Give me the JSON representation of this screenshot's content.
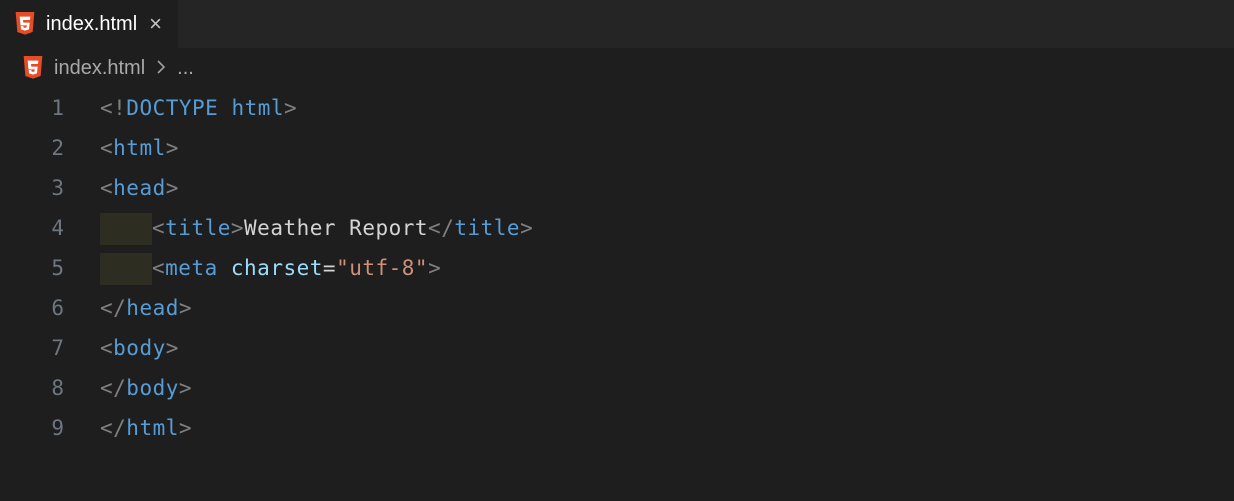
{
  "tab": {
    "title": "index.html"
  },
  "breadcrumb": {
    "file": "index.html",
    "rest": "..."
  },
  "lines": [
    {
      "num": "1",
      "indent": 0,
      "highlightIndent": false,
      "tokens": [
        {
          "cls": "p-gray",
          "t": "<!"
        },
        {
          "cls": "p-blue",
          "t": "DOCTYPE"
        },
        {
          "cls": "p-white",
          "t": " "
        },
        {
          "cls": "p-blue",
          "t": "html"
        },
        {
          "cls": "p-gray",
          "t": ">"
        }
      ]
    },
    {
      "num": "2",
      "indent": 0,
      "highlightIndent": false,
      "tokens": [
        {
          "cls": "p-gray",
          "t": "<"
        },
        {
          "cls": "p-blue",
          "t": "html"
        },
        {
          "cls": "p-gray",
          "t": ">"
        }
      ]
    },
    {
      "num": "3",
      "indent": 0,
      "highlightIndent": false,
      "tokens": [
        {
          "cls": "p-gray",
          "t": "<"
        },
        {
          "cls": "p-blue",
          "t": "head"
        },
        {
          "cls": "p-gray",
          "t": ">"
        }
      ]
    },
    {
      "num": "4",
      "indent": 1,
      "highlightIndent": true,
      "tokens": [
        {
          "cls": "p-gray",
          "t": "<"
        },
        {
          "cls": "p-blue",
          "t": "title"
        },
        {
          "cls": "p-gray",
          "t": ">"
        },
        {
          "cls": "p-white",
          "t": "Weather Report"
        },
        {
          "cls": "p-gray",
          "t": "</"
        },
        {
          "cls": "p-blue",
          "t": "title"
        },
        {
          "cls": "p-gray",
          "t": ">"
        }
      ]
    },
    {
      "num": "5",
      "indent": 1,
      "highlightIndent": true,
      "tokens": [
        {
          "cls": "p-gray",
          "t": "<"
        },
        {
          "cls": "p-blue",
          "t": "meta"
        },
        {
          "cls": "p-white",
          "t": " "
        },
        {
          "cls": "p-attr",
          "t": "charset"
        },
        {
          "cls": "p-white",
          "t": "="
        },
        {
          "cls": "p-str",
          "t": "\"utf-8\""
        },
        {
          "cls": "p-gray",
          "t": ">"
        }
      ]
    },
    {
      "num": "6",
      "indent": 0,
      "highlightIndent": false,
      "tokens": [
        {
          "cls": "p-gray",
          "t": "</"
        },
        {
          "cls": "p-blue",
          "t": "head"
        },
        {
          "cls": "p-gray",
          "t": ">"
        }
      ]
    },
    {
      "num": "7",
      "indent": 0,
      "highlightIndent": false,
      "tokens": [
        {
          "cls": "p-gray",
          "t": "<"
        },
        {
          "cls": "p-blue",
          "t": "body"
        },
        {
          "cls": "p-gray",
          "t": ">"
        }
      ]
    },
    {
      "num": "8",
      "indent": 0,
      "highlightIndent": false,
      "tokens": [
        {
          "cls": "p-gray",
          "t": "</"
        },
        {
          "cls": "p-blue",
          "t": "body"
        },
        {
          "cls": "p-gray",
          "t": ">"
        }
      ]
    },
    {
      "num": "9",
      "indent": 0,
      "highlightIndent": false,
      "tokens": [
        {
          "cls": "p-gray",
          "t": "</"
        },
        {
          "cls": "p-blue",
          "t": "html"
        },
        {
          "cls": "p-gray",
          "t": ">"
        }
      ]
    }
  ]
}
